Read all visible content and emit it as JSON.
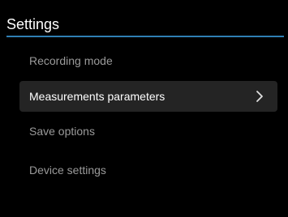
{
  "header": {
    "title": "Settings",
    "accent_color": "#2f7fb4"
  },
  "menu": {
    "items": [
      {
        "label": "Recording mode",
        "selected": false
      },
      {
        "label": "Measurements parameters",
        "selected": true,
        "icon": "chevron-right-icon"
      },
      {
        "label": "Save options",
        "selected": false
      },
      {
        "label": "Device settings",
        "selected": false
      }
    ]
  }
}
